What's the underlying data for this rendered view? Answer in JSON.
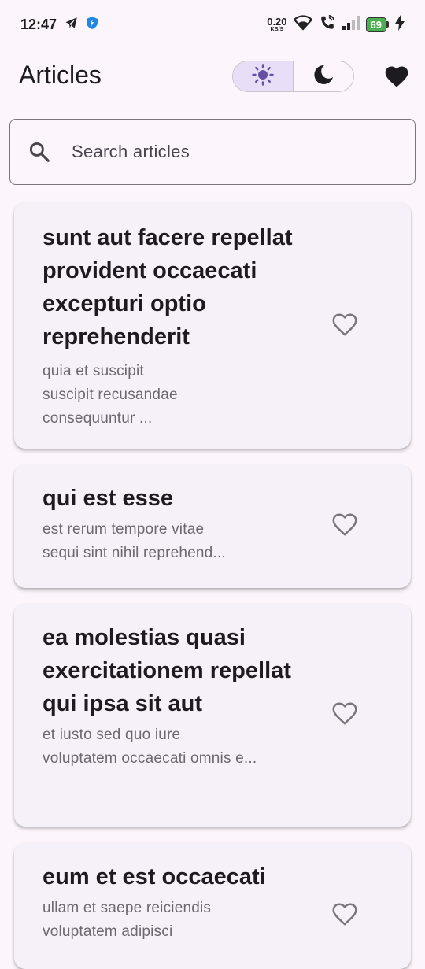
{
  "status_bar": {
    "time": "12:47",
    "net_speed_value": "0.20",
    "net_speed_unit": "KB/S",
    "battery": "69"
  },
  "app_bar": {
    "title": "Articles"
  },
  "search": {
    "placeholder": "Search articles",
    "value": ""
  },
  "articles": [
    {
      "title": "sunt aut facere repellat provident occaecati excepturi optio reprehenderit",
      "body": "quia et suscipit\nsuscipit recusandae consequuntur ..."
    },
    {
      "title": "qui est esse",
      "body": "est rerum tempore vitae\nsequi sint nihil reprehend..."
    },
    {
      "title": "ea molestias quasi exercitationem repellat qui ipsa sit aut",
      "body": "et iusto sed quo iure\nvoluptatem occaecati omnis e..."
    },
    {
      "title": "eum et est occaecati",
      "body": "ullam et saepe reiciendis\nvoluptatem adipisci"
    }
  ],
  "colors": {
    "background": "#fcf6fc",
    "card": "#f6f1f8",
    "accent": "#6750a4",
    "toggle_selected": "#e8def8"
  }
}
